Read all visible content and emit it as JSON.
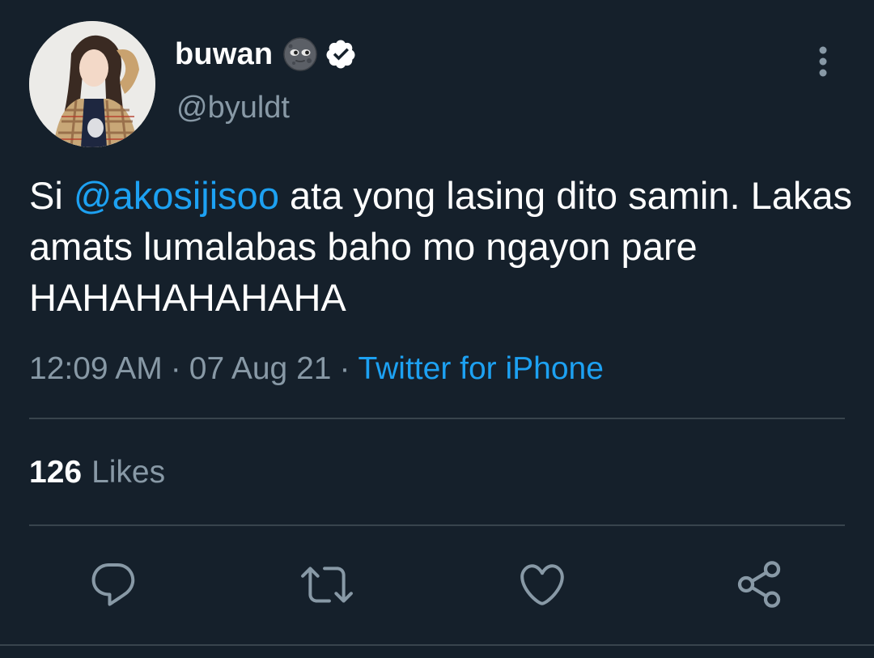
{
  "user": {
    "display_name": "buwan",
    "handle": "@byuldt",
    "emoji_icon": "new-moon-face",
    "verified": true
  },
  "tweet": {
    "prefix": "Si ",
    "mention": "@akosijisoo",
    "text_after_mention": " ata yong lasing dito samin. Lakas amats lumalabas baho mo ngayon pare HAHAHAHAHAHA",
    "time": "12:09 AM",
    "date": "07 Aug 21",
    "separator": "·",
    "source": "Twitter for iPhone"
  },
  "stats": {
    "likes_count": "126",
    "likes_label": "Likes"
  },
  "actions": [
    "reply-icon",
    "retweet-icon",
    "like-icon",
    "share-icon"
  ],
  "colors": {
    "background": "#15202b",
    "accent": "#1da1f2",
    "muted": "#8899a6",
    "divider": "#38444d"
  }
}
